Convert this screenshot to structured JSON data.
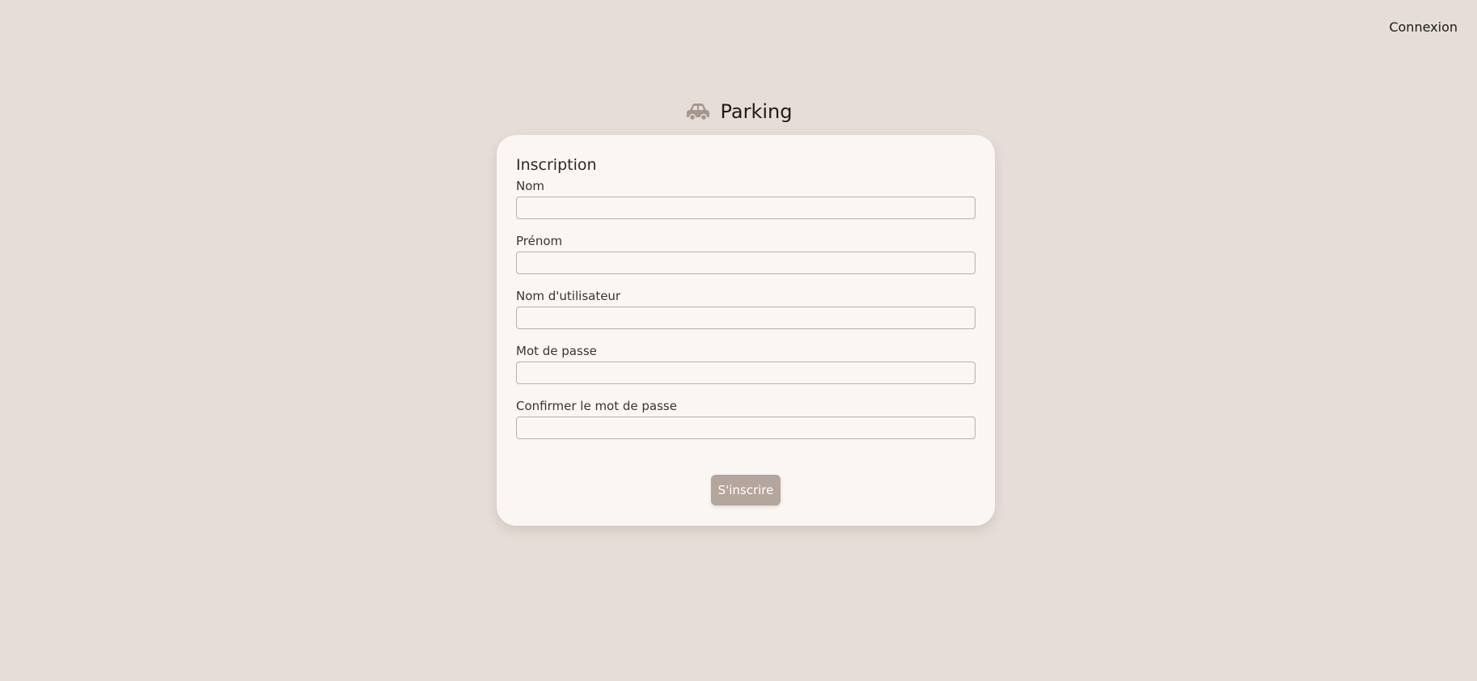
{
  "header": {
    "login_label": "Connexion"
  },
  "brand": {
    "title": "Parking",
    "icon": "car-icon",
    "icon_color": "#a59690"
  },
  "form": {
    "title": "Inscription",
    "fields": [
      {
        "label": "Nom",
        "value": ""
      },
      {
        "label": "Prénom",
        "value": ""
      },
      {
        "label": "Nom d'utilisateur",
        "value": ""
      },
      {
        "label": "Mot de passe",
        "value": ""
      },
      {
        "label": "Confirmer le mot de passe",
        "value": ""
      }
    ],
    "submit_label": "S'inscrire"
  },
  "colors": {
    "background": "#e7ddd8",
    "card": "#faf6f4",
    "button": "#b4a59d"
  }
}
